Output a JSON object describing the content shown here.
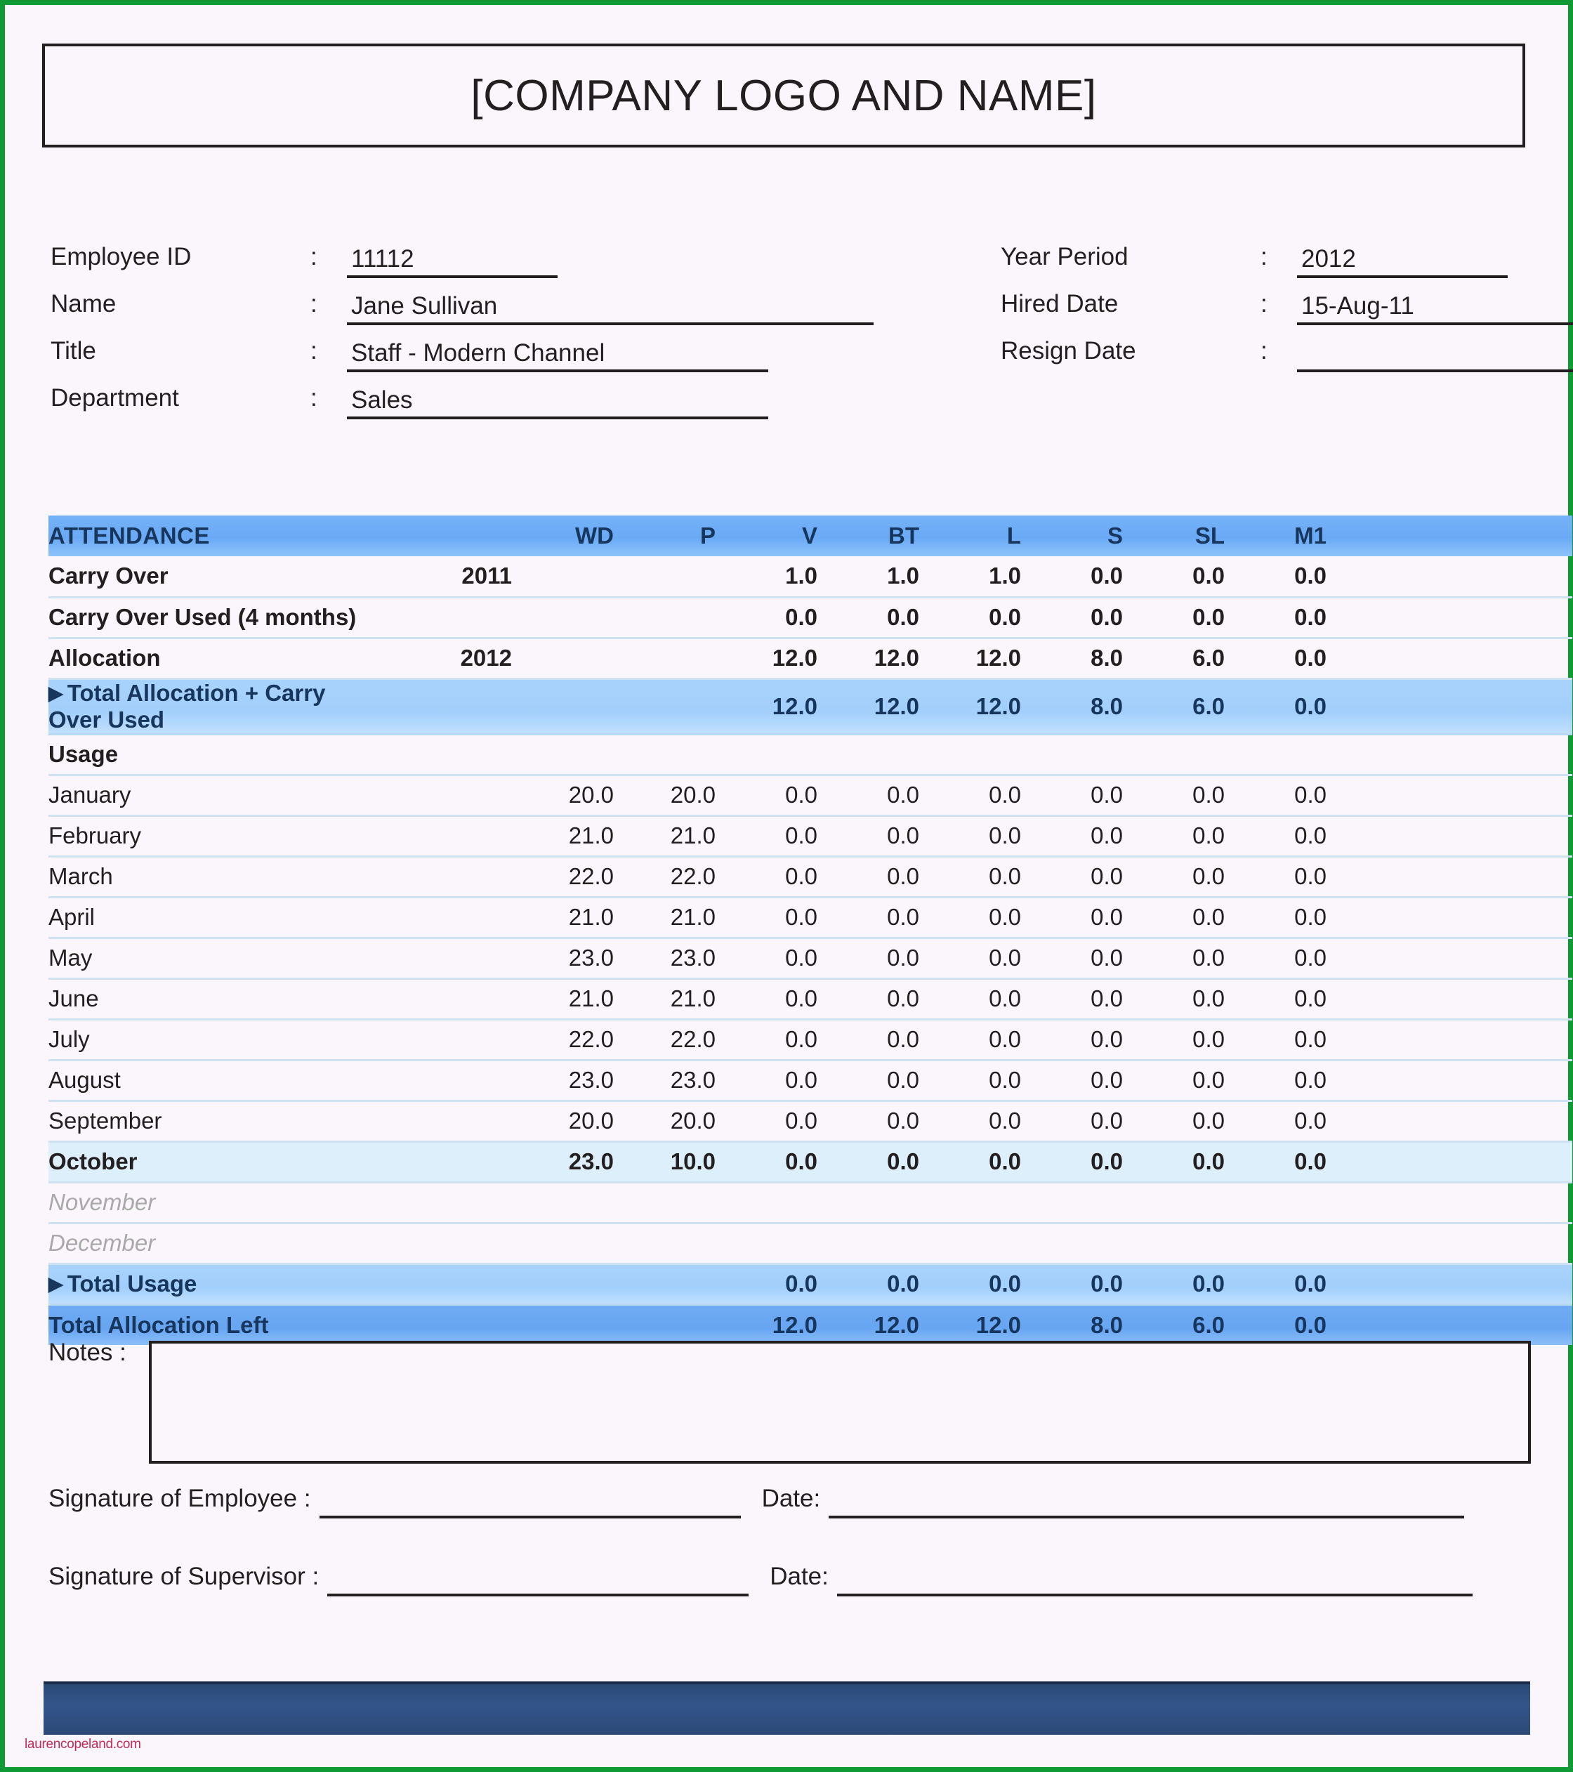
{
  "header": {
    "title": "[COMPANY LOGO AND NAME]"
  },
  "info": {
    "colon": ":",
    "left": [
      {
        "label": "Employee ID",
        "value": "11112"
      },
      {
        "label": "Name",
        "value": "Jane Sullivan"
      },
      {
        "label": "Title",
        "value": "Staff - Modern Channel"
      },
      {
        "label": "Department",
        "value": "Sales"
      }
    ],
    "right": [
      {
        "label": "Year Period",
        "value": "2012"
      },
      {
        "label": "Hired Date",
        "value": "15-Aug-11"
      },
      {
        "label": "Resign Date",
        "value": ""
      }
    ]
  },
  "attendance": {
    "header": {
      "title": "ATTENDANCE",
      "year": "",
      "columns": [
        "WD",
        "P",
        "V",
        "BT",
        "L",
        "S",
        "SL",
        "M1"
      ]
    },
    "carry_over": {
      "label": "Carry Over",
      "year": "2011",
      "wd": "",
      "p": "",
      "values": [
        "1.0",
        "1.0",
        "1.0",
        "0.0",
        "0.0",
        "0.0"
      ]
    },
    "carry_over_used": {
      "label": "Carry Over Used (4 months)",
      "year": "",
      "wd": "",
      "p": "",
      "values": [
        "0.0",
        "0.0",
        "0.0",
        "0.0",
        "0.0",
        "0.0"
      ]
    },
    "allocation": {
      "label": "Allocation",
      "year": "2012",
      "wd": "",
      "p": "",
      "values": [
        "12.0",
        "12.0",
        "12.0",
        "8.0",
        "6.0",
        "0.0"
      ]
    },
    "total_allocation_carry": {
      "label": "Total Allocation + Carry Over Used",
      "arrow": "▶",
      "values": [
        "12.0",
        "12.0",
        "12.0",
        "8.0",
        "6.0",
        "0.0"
      ]
    },
    "usage_label": "Usage",
    "months": [
      {
        "label": "January",
        "wd": "20.0",
        "p": "20.0",
        "values": [
          "0.0",
          "0.0",
          "0.0",
          "0.0",
          "0.0",
          "0.0"
        ],
        "state": "normal"
      },
      {
        "label": "February",
        "wd": "21.0",
        "p": "21.0",
        "values": [
          "0.0",
          "0.0",
          "0.0",
          "0.0",
          "0.0",
          "0.0"
        ],
        "state": "normal"
      },
      {
        "label": "March",
        "wd": "22.0",
        "p": "22.0",
        "values": [
          "0.0",
          "0.0",
          "0.0",
          "0.0",
          "0.0",
          "0.0"
        ],
        "state": "normal"
      },
      {
        "label": "April",
        "wd": "21.0",
        "p": "21.0",
        "values": [
          "0.0",
          "0.0",
          "0.0",
          "0.0",
          "0.0",
          "0.0"
        ],
        "state": "normal"
      },
      {
        "label": "May",
        "wd": "23.0",
        "p": "23.0",
        "values": [
          "0.0",
          "0.0",
          "0.0",
          "0.0",
          "0.0",
          "0.0"
        ],
        "state": "normal"
      },
      {
        "label": "June",
        "wd": "21.0",
        "p": "21.0",
        "values": [
          "0.0",
          "0.0",
          "0.0",
          "0.0",
          "0.0",
          "0.0"
        ],
        "state": "normal"
      },
      {
        "label": "July",
        "wd": "22.0",
        "p": "22.0",
        "values": [
          "0.0",
          "0.0",
          "0.0",
          "0.0",
          "0.0",
          "0.0"
        ],
        "state": "normal"
      },
      {
        "label": "August",
        "wd": "23.0",
        "p": "23.0",
        "values": [
          "0.0",
          "0.0",
          "0.0",
          "0.0",
          "0.0",
          "0.0"
        ],
        "state": "normal"
      },
      {
        "label": "September",
        "wd": "20.0",
        "p": "20.0",
        "values": [
          "0.0",
          "0.0",
          "0.0",
          "0.0",
          "0.0",
          "0.0"
        ],
        "state": "normal"
      },
      {
        "label": "October",
        "wd": "23.0",
        "p": "10.0",
        "values": [
          "0.0",
          "0.0",
          "0.0",
          "0.0",
          "0.0",
          "0.0"
        ],
        "state": "current"
      },
      {
        "label": "November",
        "wd": "",
        "p": "",
        "values": [
          "",
          "",
          "",
          "",
          "",
          ""
        ],
        "state": "future"
      },
      {
        "label": "December",
        "wd": "",
        "p": "",
        "values": [
          "",
          "",
          "",
          "",
          "",
          ""
        ],
        "state": "future"
      }
    ],
    "total_usage": {
      "label": "Total Usage",
      "arrow": "▶",
      "values": [
        "0.0",
        "0.0",
        "0.0",
        "0.0",
        "0.0",
        "0.0"
      ]
    },
    "total_allocation_left": {
      "label": "Total Allocation Left",
      "values": [
        "12.0",
        "12.0",
        "12.0",
        "8.0",
        "6.0",
        "0.0"
      ]
    }
  },
  "notes": {
    "label": "Notes :",
    "value": ""
  },
  "signatures": {
    "employee_label": "Signature of Employee :",
    "supervisor_label": "Signature of Supervisor :",
    "date_label": "Date:",
    "employee_value": "",
    "supervisor_value": "",
    "employee_date": "",
    "supervisor_date": ""
  },
  "footer": {
    "watermark": "laurencopeland.com"
  },
  "colors": {
    "header_blue": "#6aa9f5",
    "subtotal_blue": "#a2cffb",
    "total_blue": "#68a5f2",
    "current_month": "#ddeffb",
    "navy_text": "#17365d",
    "footer_bar": "#33558a",
    "watermark": "#c02c56",
    "page_border": "#0f9a35"
  }
}
